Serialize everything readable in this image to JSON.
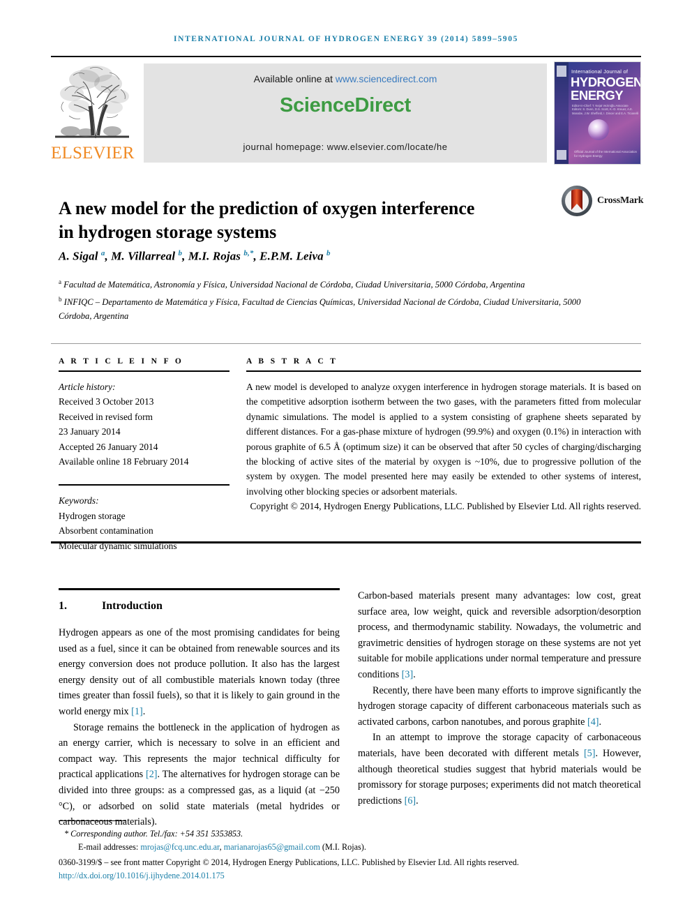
{
  "running_head": "INTERNATIONAL JOURNAL OF HYDROGEN ENERGY 39 (2014) 5899–5905",
  "masthead": {
    "publisher": "ELSEVIER",
    "available_prefix": "Available online at ",
    "available_url": "www.sciencedirect.com",
    "wordmark": "ScienceDirect",
    "homepage": "journal homepage: www.elsevier.com/locate/he",
    "cover": {
      "line1": "International Journal of",
      "line2": "HYDROGEN",
      "line3": "ENERGY",
      "meta": "Editor-in-Chief:  T. Nejat Veziroğlu\nAssociate Editors:  S. Dunn, D.S. Scott, K.-D. Kreuer, A.E. Manabe, J.W. Sheffield, I. Dincer and E.A. Ticianelli",
      "footer": "Official Journal of the International Association for Hydrogen Energy"
    }
  },
  "crossmark": {
    "label": "CrossMark"
  },
  "article": {
    "title": "A new model for the prediction of oxygen interference in hydrogen storage systems",
    "authors_html": "A. Sigal <sup>a</sup>, M. Villarreal <sup>b</sup>, M.I. Rojas <sup>b,*</sup>, E.P.M. Leiva <sup>b</sup>",
    "affiliations": [
      "a Facultad de Matemática, Astronomía y Física, Universidad Nacional de Córdoba, Ciudad Universitaria, 5000 Córdoba, Argentina",
      "b INFIQC – Departamento de Matemática y Física, Facultad de Ciencias Químicas, Universidad Nacional de Córdoba, Ciudad Universitaria, 5000 Córdoba, Argentina"
    ]
  },
  "article_info": {
    "label": "A R T I C L E   I N F O",
    "history_label": "Article history:",
    "history": [
      "Received 3 October 2013",
      "Received in revised form",
      "23 January 2014",
      "Accepted 26 January 2014",
      "Available online 18 February 2014"
    ],
    "keywords_label": "Keywords:",
    "keywords": [
      "Hydrogen storage",
      "Absorbent contamination",
      "Molecular dynamic simulations"
    ]
  },
  "abstract": {
    "label": "A B S T R A C T",
    "text": "A new model is developed to analyze oxygen interference in hydrogen storage materials. It is based on the competitive adsorption isotherm between the two gases, with the parameters fitted from molecular dynamic simulations. The model is applied to a system consisting of graphene sheets separated by different distances. For a gas-phase mixture of hydrogen (99.9%) and oxygen (0.1%) in interaction with porous graphite of 6.5 Å (optimum size) it can be observed that after 50 cycles of charging/discharging the blocking of active sites of the material by oxygen is ~10%, due to progressive pollution of the system by oxygen. The model presented here may easily be extended to other systems of interest, involving other blocking species or adsorbent materials.",
    "copyright": "Copyright © 2014, Hydrogen Energy Publications, LLC. Published by Elsevier Ltd. All rights reserved."
  },
  "body": {
    "section_number": "1.",
    "section_title": "Introduction",
    "left_paragraphs_html": [
      "Hydrogen appears as one of the most promising candidates for being used as a fuel, since it can be obtained from renewable sources and its energy conversion does not produce pollution. It also has the largest energy density out of all combustible materials known today (three times greater than fossil fuels), so that it is likely to gain ground in the world energy mix <span class=\"ref\">[1]</span>.",
      "Storage remains the bottleneck in the application of hydrogen as an energy carrier, which is necessary to solve in an efficient and compact way. This represents the major technical difficulty for practical applications <span class=\"ref\">[2]</span>. The alternatives for hydrogen storage can be divided into three groups: as a compressed gas, as a liquid (at −250 °C), or adsorbed on solid state materials (metal hydrides or carbonaceous materials)."
    ],
    "right_paragraphs_html": [
      "Carbon-based materials present many advantages: low cost, great surface area, low weight, quick and reversible adsorption/desorption process, and thermodynamic stability. Nowadays, the volumetric and gravimetric densities of hydrogen storage on these systems are not yet suitable for mobile applications under normal temperature and pressure conditions <span class=\"ref\">[3]</span>.",
      "Recently, there have been many efforts to improve significantly the hydrogen storage capacity of different carbonaceous materials such as activated carbons, carbon nanotubes, and porous graphite <span class=\"ref\">[4]</span>.",
      "In an attempt to improve the storage capacity of carbonaceous materials, have been decorated with different metals <span class=\"ref\">[5]</span>. However, although theoretical studies suggest that hybrid materials would be promissory for storage purposes; experiments did not match theoretical predictions <span class=\"ref\">[6]</span>."
    ]
  },
  "footer": {
    "corresponding_html": "* <em>Corresponding author. Tel./fax: +54 351 5353853.</em>",
    "emails_html": "E-mail addresses: <span class=\"link\">mrojas@fcq.unc.edu.ar</span>, <span class=\"link\">marianarojas65@gmail.com</span> (M.I. Rojas).",
    "issn_line": "0360-3199/$ – see front matter Copyright © 2014, Hydrogen Energy Publications, LLC. Published by Elsevier Ltd. All rights reserved.",
    "doi": "http://dx.doi.org/10.1016/j.ijhydene.2014.01.175"
  },
  "colors": {
    "accent_blue": "#1b7fa8",
    "sciencedirect_green": "#3d9b43",
    "elsevier_orange": "#f08a24",
    "link_blue": "#3a7bbf"
  }
}
